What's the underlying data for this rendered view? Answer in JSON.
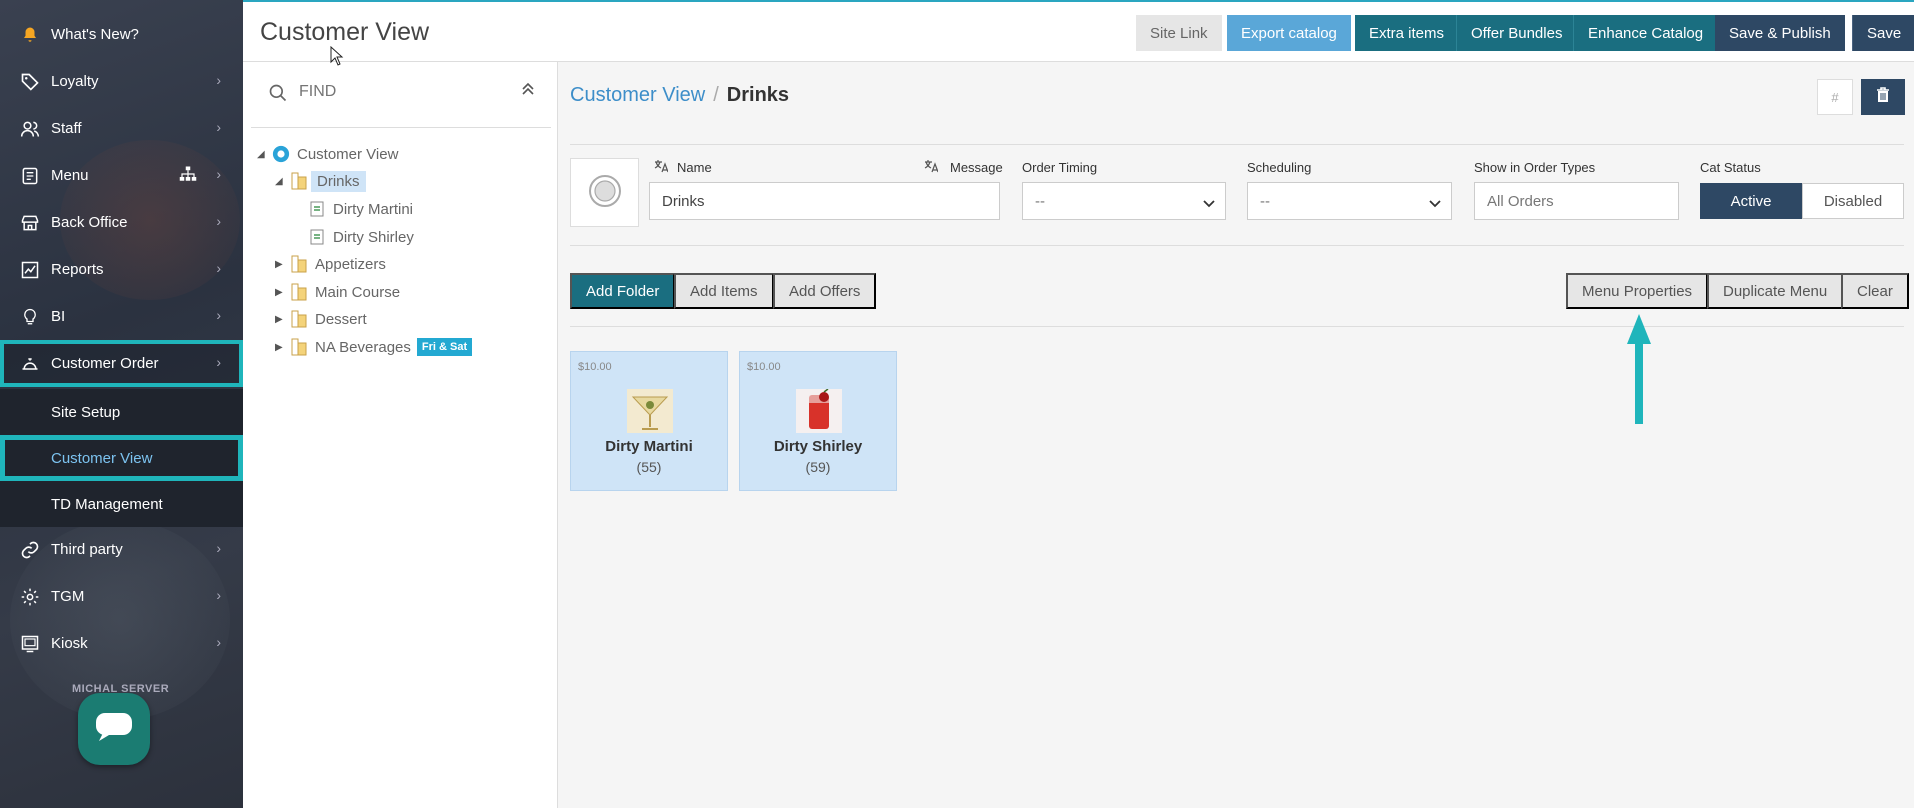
{
  "sidebar": {
    "items": [
      {
        "label": "What's New?",
        "icon": "bell-icon"
      },
      {
        "label": "Loyalty",
        "icon": "tag-icon"
      },
      {
        "label": "Staff",
        "icon": "users-icon"
      },
      {
        "label": "Menu",
        "icon": "menu-book-icon"
      },
      {
        "label": "Back Office",
        "icon": "store-icon"
      },
      {
        "label": "Reports",
        "icon": "chart-icon"
      },
      {
        "label": "BI",
        "icon": "lightbulb-icon"
      },
      {
        "label": "Customer Order",
        "icon": "cloche-icon"
      },
      {
        "label": "Third party",
        "icon": "link-icon"
      },
      {
        "label": "TGM",
        "icon": "gear-icon"
      },
      {
        "label": "Kiosk",
        "icon": "kiosk-icon"
      }
    ],
    "sub_items": [
      {
        "label": "Site Setup"
      },
      {
        "label": "Customer View"
      },
      {
        "label": "TD Management"
      }
    ],
    "user_label": "MICHAL SERVER"
  },
  "header": {
    "title": "Customer View",
    "buttons": {
      "site_link": "Site Link",
      "export_catalog": "Export catalog",
      "extra_items": "Extra items",
      "offer_bundles": "Offer Bundles",
      "enhance_catalog": "Enhance Catalog",
      "save_publish": "Save & Publish",
      "save": "Save"
    }
  },
  "tree": {
    "find_placeholder": "FIND",
    "root": "Customer View",
    "nodes": [
      {
        "label": "Drinks"
      },
      {
        "label": "Dirty Martini"
      },
      {
        "label": "Dirty Shirley"
      },
      {
        "label": "Appetizers"
      },
      {
        "label": "Main Course"
      },
      {
        "label": "Dessert"
      },
      {
        "label": "NA Beverages",
        "badge": "Fri & Sat"
      }
    ]
  },
  "main": {
    "breadcrumb": {
      "parent": "Customer View",
      "separator": "/",
      "current": "Drinks"
    },
    "hash_label": "#",
    "form": {
      "name_label": "Name",
      "name_value": "Drinks",
      "message_label": "Message",
      "order_timing_label": "Order Timing",
      "order_timing_value": "--",
      "scheduling_label": "Scheduling",
      "scheduling_value": "--",
      "order_types_label": "Show in Order Types",
      "order_types_value": "All Orders",
      "cat_status_label": "Cat Status",
      "status_active": "Active",
      "status_disabled": "Disabled"
    },
    "actions": {
      "add_folder": "Add Folder",
      "add_items": "Add Items",
      "add_offers": "Add Offers",
      "menu_properties": "Menu Properties",
      "duplicate_menu": "Duplicate Menu",
      "clear": "Clear"
    },
    "cards": [
      {
        "price": "$10.00",
        "name": "Dirty Martini",
        "count": "(55)"
      },
      {
        "price": "$10.00",
        "name": "Dirty Shirley",
        "count": "(59)"
      }
    ]
  },
  "colors": {
    "accent_teal": "#1fb5bb",
    "dark_navy": "#2e4864",
    "teal_button": "#1a6e80",
    "link_blue": "#3d8ec9"
  }
}
